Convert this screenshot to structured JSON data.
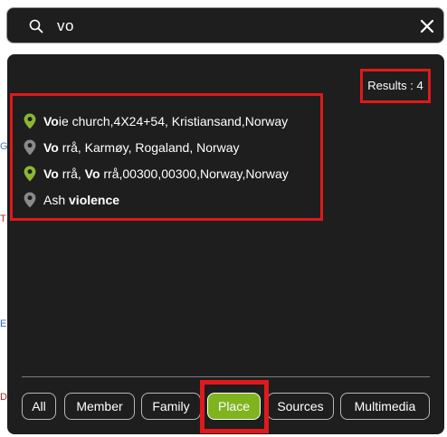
{
  "search": {
    "query": "vo"
  },
  "results": {
    "count_label": "Results : 4",
    "items": [
      {
        "match": "Vo",
        "rest": "ie church,4X24+54, Kristiansand,Norway",
        "pin_color": "#8ab833"
      },
      {
        "match": "Vo",
        "rest": " rrå, Karmøy, Rogaland, Norway",
        "pin_color": "#8a8a8a"
      },
      {
        "match": "Vo",
        "mid": " rrå, ",
        "match2": "Vo",
        "rest": " rrå,00300,00300,Norway,Norway",
        "pin_color": "#8ab833"
      },
      {
        "prefix": "Ash ",
        "match": "violence",
        "pin_color": "#8a8a8a"
      }
    ]
  },
  "filters": [
    {
      "label": "All",
      "active": false
    },
    {
      "label": "Member",
      "active": false
    },
    {
      "label": "Family",
      "active": false
    },
    {
      "label": "Place",
      "active": true
    },
    {
      "label": "Sources",
      "active": false
    },
    {
      "label": "Multimedia",
      "active": false
    }
  ],
  "background_fragments": [
    "G",
    "T",
    "E",
    "D"
  ],
  "colors": {
    "panel_bg": "#1e1e1e",
    "highlight_red": "#e0191b",
    "active_filter_green": "#7fb41e"
  },
  "icons": [
    "search-icon",
    "close-icon",
    "map-pin-icon"
  ]
}
